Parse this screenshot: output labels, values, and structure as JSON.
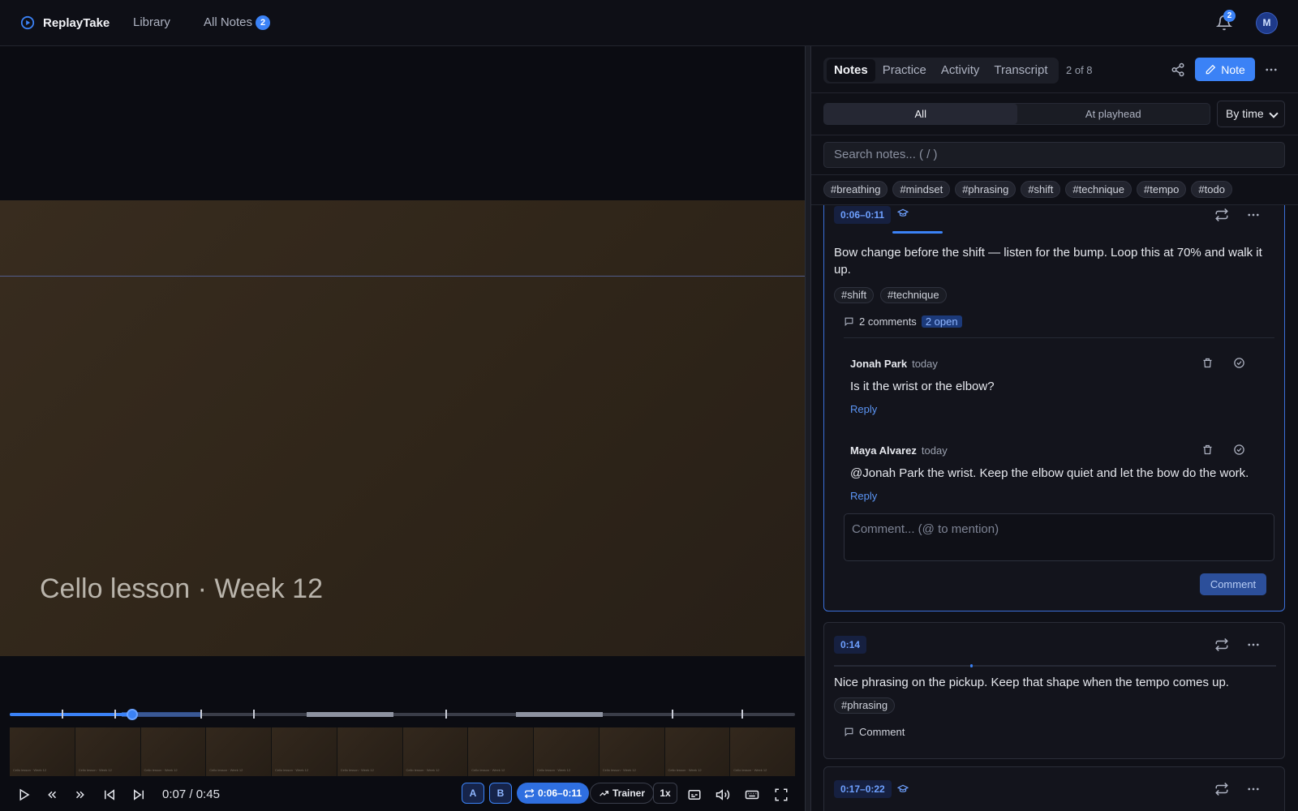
{
  "app": {
    "name": "ReplayTake"
  },
  "nav": {
    "library": "Library",
    "all_notes": "All Notes",
    "all_notes_count": "2"
  },
  "header": {
    "notification_count": "2",
    "avatar_initial": "M"
  },
  "video": {
    "title": "Cello lesson · Week 12",
    "current_time": "0:07",
    "separator": "/",
    "duration": "0:45",
    "progress_fraction": 0.156,
    "thumb_caption": "Cello lesson · Week 12"
  },
  "controls": {
    "a_label": "A",
    "b_label": "B",
    "loop_range": "0:06–0:11",
    "trainer_label": "Trainer",
    "speed": "1x"
  },
  "panel": {
    "tabs": [
      "Notes",
      "Practice",
      "Activity",
      "Transcript"
    ],
    "active_tab": "Notes",
    "counter": "2 of 8",
    "note_button": "Note",
    "filter_all": "All",
    "filter_playhead": "At playhead",
    "sort": "By time",
    "search_placeholder": "Search notes... ( / )",
    "tags": [
      "#breathing",
      "#mindset",
      "#phrasing",
      "#shift",
      "#technique",
      "#tempo",
      "#todo"
    ]
  },
  "notes": [
    {
      "time": "0:06–0:11",
      "text_line1": "Bow change before the shift — listen for the bump. Loop this at 70% and walk it",
      "text_line2": "up.",
      "tags": [
        "#shift",
        "#technique"
      ],
      "comments_label": "2 comments",
      "open_label": "2 open",
      "comments": [
        {
          "author": "Jonah Park",
          "when": "today",
          "text": "Is it the wrist or the elbow?",
          "reply": "Reply"
        },
        {
          "author": "Maya Alvarez",
          "when": "today",
          "text": "@Jonah Park the wrist. Keep the elbow quiet and let the bow do the work.",
          "reply": "Reply"
        }
      ],
      "comment_placeholder": "Comment... (@ to mention)",
      "comment_button": "Comment"
    },
    {
      "time": "0:14",
      "text": "Nice phrasing on the pickup. Keep that shape when the tempo comes up.",
      "tags": [
        "#phrasing"
      ],
      "comment_label": "Comment"
    },
    {
      "time": "0:17–0:22"
    }
  ]
}
